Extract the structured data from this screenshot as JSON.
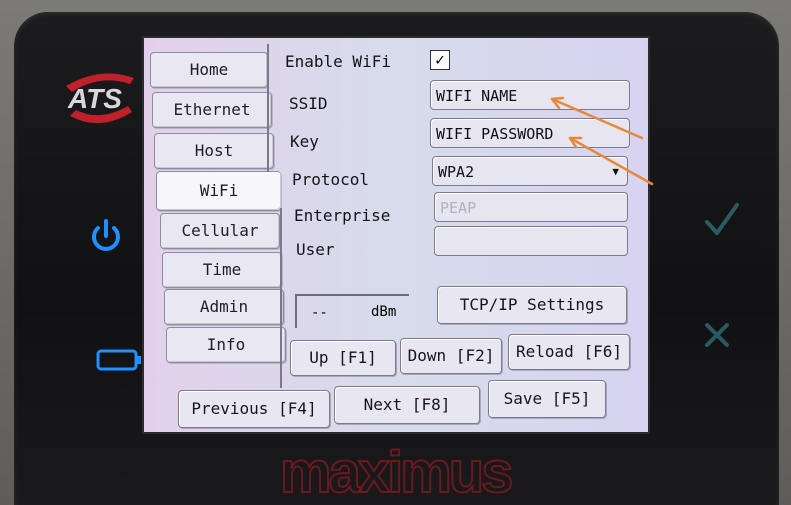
{
  "device": {
    "logo_text": "ATS",
    "brand_text": "maximus",
    "colors": {
      "power": "#1e90ff",
      "check": "#2a5b63",
      "accent_logo": "#c0202a",
      "brand": "#6a1a1e"
    }
  },
  "tabs": [
    {
      "label": "Home"
    },
    {
      "label": "Ethernet"
    },
    {
      "label": "Host"
    },
    {
      "label": "WiFi",
      "active": true
    },
    {
      "label": "Cellular"
    },
    {
      "label": "Time"
    },
    {
      "label": "Admin"
    },
    {
      "label": "Info"
    }
  ],
  "wifi": {
    "enable_label": "Enable WiFi",
    "enable_checked": "✓",
    "ssid_label": "SSID",
    "ssid_value": "WIFI NAME",
    "key_label": "Key",
    "key_value": "WIFI PASSWORD",
    "protocol_label": "Protocol",
    "protocol_value": "WPA2",
    "enterprise_label": "Enterprise",
    "enterprise_value": "PEAP",
    "user_label": "User",
    "user_value": "",
    "signal_value": "--",
    "signal_unit": "dBm",
    "tcpip_button": "TCP/IP Settings"
  },
  "buttons": {
    "up": "Up [F1]",
    "down": "Down [F2]",
    "reload": "Reload [F6]",
    "previous": "Previous [F4]",
    "next": "Next [F8]",
    "save": "Save [F5]"
  },
  "annotation_color": "#e8883a"
}
